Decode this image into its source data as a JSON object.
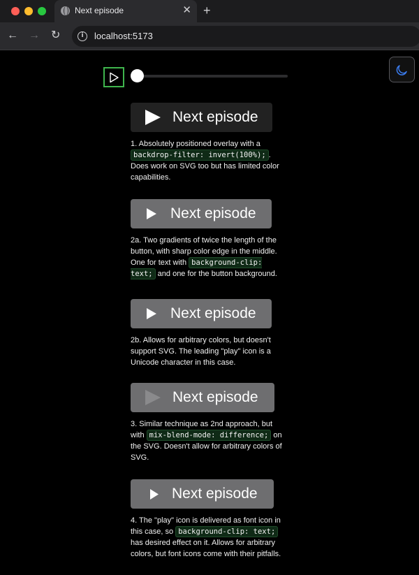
{
  "browser": {
    "tab_title": "Next episode",
    "url": "localhost:5173"
  },
  "player": {
    "progress": 0
  },
  "demos": [
    {
      "button_label": "Next episode",
      "desc_parts": [
        "1. Absolutely positioned overlay with a ",
        "backdrop-filter: invert(100%);",
        ". Does work on SVG too but has limited color capabilities."
      ]
    },
    {
      "button_label": "Next episode",
      "desc_parts": [
        "2a. Two gradients of twice the length of the button, with sharp color edge in the middle. One for text with ",
        "background-clip: text;",
        " and one for the button background."
      ]
    },
    {
      "button_label": "Next episode",
      "desc_parts": [
        "2b. Allows for arbitrary colors, but doesn't support SVG. The leading \"play\" icon is a Unicode character in this case."
      ]
    },
    {
      "button_label": "Next episode",
      "desc_parts": [
        "3. Similar technique as 2nd approach, but with ",
        "mix-blend-mode: difference;",
        " on the SVG. Doesn't allow for arbitrary colors of SVG."
      ]
    },
    {
      "button_label": "Next episode",
      "desc_parts": [
        "4. The \"play\" icon is delivered as font icon in this case, so ",
        "background-clip: text;",
        " has desired effect on it. Allows for arbitrary colors, but font icons come with their pitfalls."
      ]
    }
  ],
  "colors": {
    "accent_green": "#3fb54d",
    "button_dark": "#222222",
    "button_grey": "#6e6e70",
    "theme_icon": "#3b7df0"
  },
  "icons": [
    "globe-icon",
    "close-icon",
    "plus-icon",
    "arrow-left-icon",
    "arrow-right-icon",
    "reload-icon",
    "info-icon",
    "play-icon",
    "moon-icon"
  ]
}
